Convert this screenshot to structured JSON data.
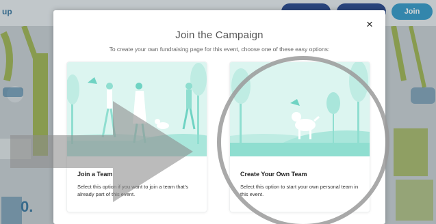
{
  "background": {
    "logo_text": "up",
    "header_buttons": [
      {
        "label": ""
      },
      {
        "label": ""
      },
      {
        "label": "Join"
      }
    ],
    "bottom_left_glyph": "0."
  },
  "modal": {
    "title": "Join the Campaign",
    "subtitle": "To create your own fundraising page for this event, choose one of these easy options:",
    "close_label": "×",
    "options": [
      {
        "title": "Join a Team",
        "description": "Select this option if you want to join a team that's already part of this event."
      },
      {
        "title": "Create Your Own Team",
        "description": "Select this option to start your own personal team in this event."
      }
    ]
  },
  "colors": {
    "teal_light": "#d6f3ee",
    "teal_mid": "#a9e6db",
    "teal_dark": "#6fd3c3",
    "annotation_gray": "#9a9a9a",
    "join_button": "#2a95c6",
    "nav_button": "#1d3d86"
  }
}
